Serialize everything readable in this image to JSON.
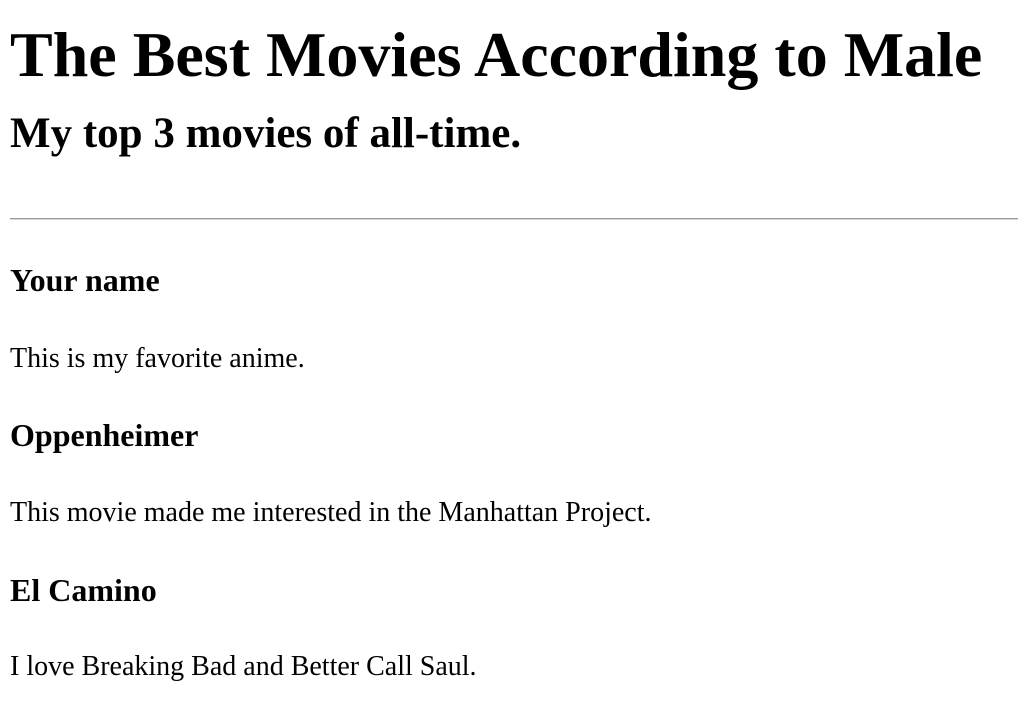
{
  "page": {
    "title": "The Best Movies According to Male",
    "subtitle": "My top 3 movies of all-time."
  },
  "movies": [
    {
      "title": "Your name",
      "description": "This is my favorite anime."
    },
    {
      "title": "Oppenheimer",
      "description": "This movie made me interested in the Manhattan Project."
    },
    {
      "title": "El Camino",
      "description": "I love Breaking Bad and Better Call Saul."
    }
  ]
}
